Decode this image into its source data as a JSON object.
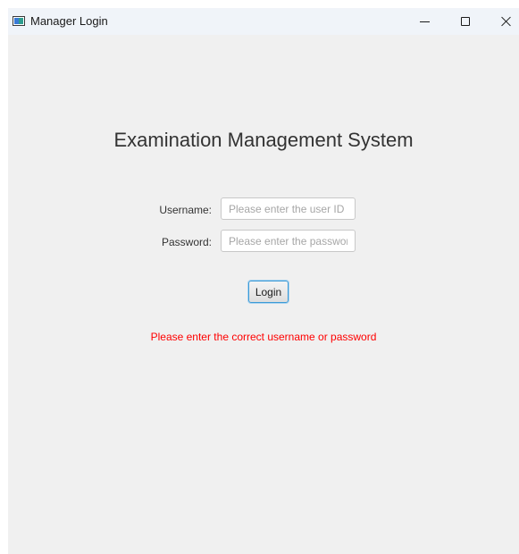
{
  "window": {
    "title": "Manager Login"
  },
  "main": {
    "heading": "Examination Management System",
    "username_label": "Username:",
    "username_value": "",
    "username_placeholder": "Please enter the user ID",
    "password_label": "Password:",
    "password_value": "",
    "password_placeholder": "Please enter the password",
    "login_label": "Login",
    "error_message": "Please enter the correct username or password"
  },
  "colors": {
    "background": "#f0f0f0",
    "error": "#ff0000",
    "button_focus": "#3c9ad6"
  },
  "icons": {
    "app": "app-window-icon",
    "minimize": "minimize-icon",
    "maximize": "maximize-icon",
    "close": "close-icon"
  }
}
